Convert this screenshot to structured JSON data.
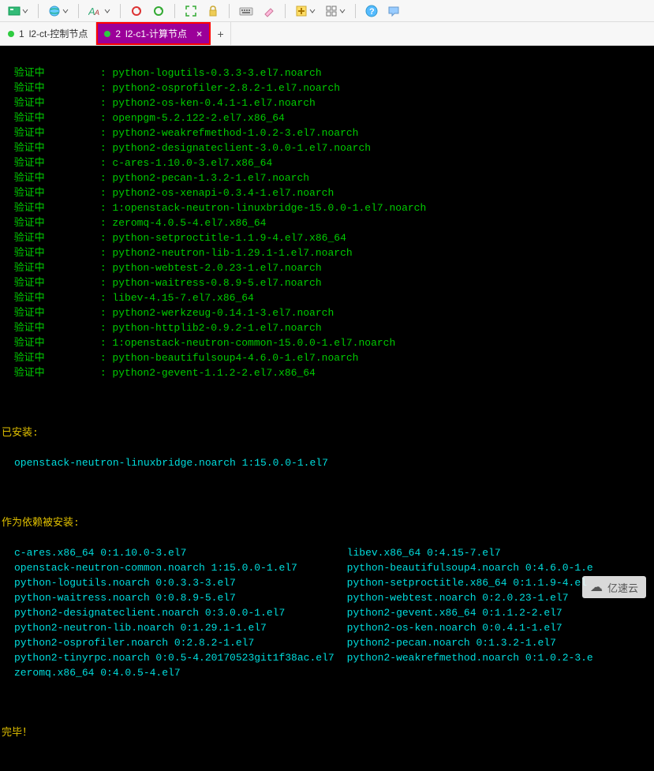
{
  "toolbar": {
    "icons": [
      "sessions",
      "world",
      "font",
      "refresh-red",
      "refresh-green",
      "fullscreen",
      "lock",
      "keyboard",
      "eraser",
      "add",
      "grid",
      "help",
      "chat"
    ]
  },
  "tabs": [
    {
      "index": "1",
      "label": "l2-ct-控制节点",
      "active": false
    },
    {
      "index": "2",
      "label": "l2-c1-计算节点",
      "active": true
    }
  ],
  "verify_label": "验证中",
  "verify_sep": ":",
  "verify": [
    "python-logutils-0.3.3-3.el7.noarch",
    "python2-osprofiler-2.8.2-1.el7.noarch",
    "python2-os-ken-0.4.1-1.el7.noarch",
    "openpgm-5.2.122-2.el7.x86_64",
    "python2-weakrefmethod-1.0.2-3.el7.noarch",
    "python2-designateclient-3.0.0-1.el7.noarch",
    "c-ares-1.10.0-3.el7.x86_64",
    "python2-pecan-1.3.2-1.el7.noarch",
    "python2-os-xenapi-0.3.4-1.el7.noarch",
    "1:openstack-neutron-linuxbridge-15.0.0-1.el7.noarch",
    "zeromq-4.0.5-4.el7.x86_64",
    "python-setproctitle-1.1.9-4.el7.x86_64",
    "python2-neutron-lib-1.29.1-1.el7.noarch",
    "python-webtest-2.0.23-1.el7.noarch",
    "python-waitress-0.8.9-5.el7.noarch",
    "libev-4.15-7.el7.x86_64",
    "python2-werkzeug-0.14.1-3.el7.noarch",
    "python-httplib2-0.9.2-1.el7.noarch",
    "1:openstack-neutron-common-15.0.0-1.el7.noarch",
    "python-beautifulsoup4-4.6.0-1.el7.noarch",
    "python2-gevent-1.1.2-2.el7.x86_64"
  ],
  "installed_header": "已安装:",
  "installed": "openstack-neutron-linuxbridge.noarch 1:15.0.0-1.el7",
  "deps_header": "作为依赖被安装:",
  "deps_left": [
    "c-ares.x86_64 0:1.10.0-3.el7",
    "openstack-neutron-common.noarch 1:15.0.0-1.el7",
    "python-logutils.noarch 0:0.3.3-3.el7",
    "python-waitress.noarch 0:0.8.9-5.el7",
    "python2-designateclient.noarch 0:3.0.0-1.el7",
    "python2-neutron-lib.noarch 0:1.29.1-1.el7",
    "python2-osprofiler.noarch 0:2.8.2-1.el7",
    "python2-tinyrpc.noarch 0:0.5-4.20170523git1f38ac.el7",
    "zeromq.x86_64 0:4.0.5-4.el7"
  ],
  "deps_right": [
    "libev.x86_64 0:4.15-7.el7",
    "python-beautifulsoup4.noarch 0:4.6.0-1.e",
    "python-setproctitle.x86_64 0:1.1.9-4.el",
    "python-webtest.noarch 0:2.0.23-1.el7",
    "python2-gevent.x86_64 0:1.1.2-2.el7",
    "python2-os-ken.noarch 0:0.4.1-1.el7",
    "python2-pecan.noarch 0:1.3.2-1.el7",
    "python2-weakrefmethod.noarch 0:1.0.2-3.e"
  ],
  "done": "完毕！",
  "watermark": "亿速云"
}
